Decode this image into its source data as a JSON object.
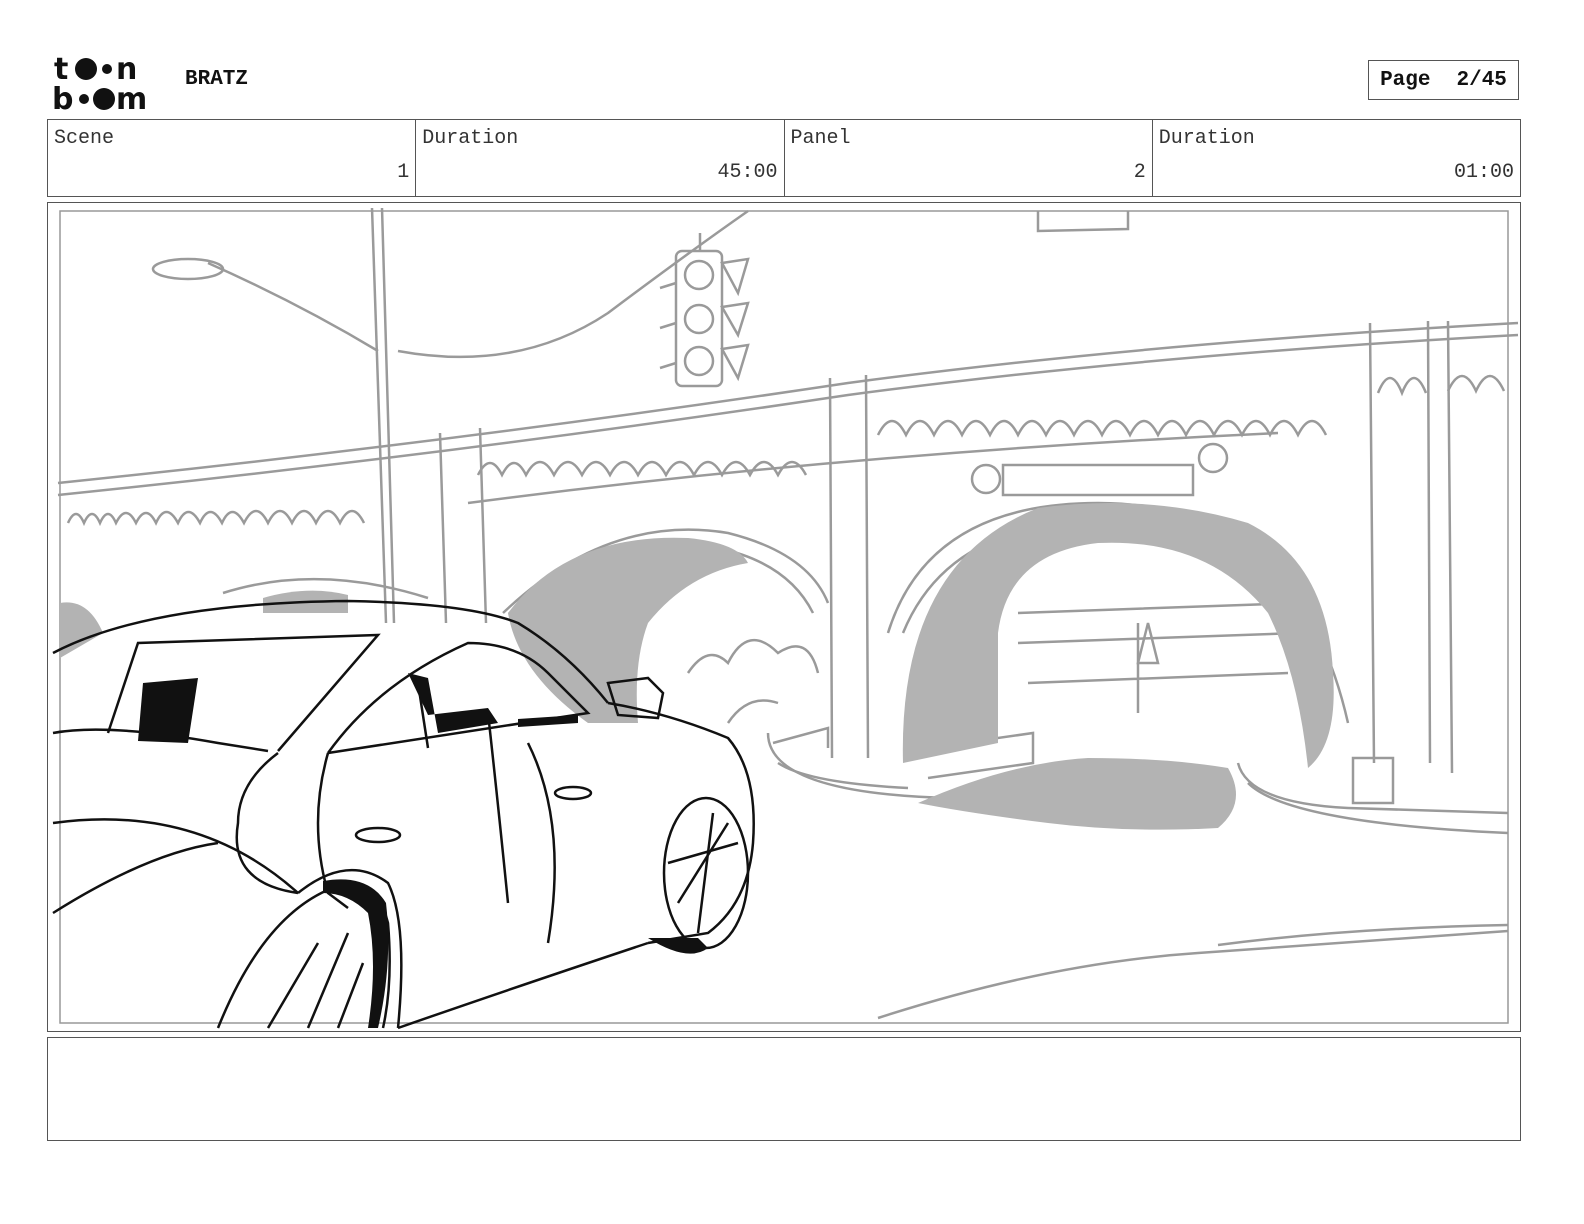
{
  "header": {
    "logo_text": "toon boom",
    "project_title": "BRATZ",
    "page_label": "Page",
    "page_number": "2/45"
  },
  "info": {
    "scene_label": "Scene",
    "scene_value": "1",
    "scene_duration_label": "Duration",
    "scene_duration_value": "45:00",
    "panel_label": "Panel",
    "panel_value": "2",
    "panel_duration_label": "Duration",
    "panel_duration_value": "01:00"
  },
  "panel": {
    "drawing": "storyboard-sketch-car-under-arched-overpass"
  },
  "notes": {
    "text": ""
  }
}
